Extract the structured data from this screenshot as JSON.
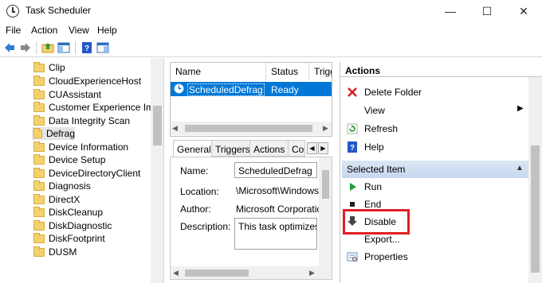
{
  "window": {
    "title": "Task Scheduler",
    "minimize": "—",
    "maximize": "☐",
    "close": "✕"
  },
  "menu": [
    "File",
    "Action",
    "View",
    "Help"
  ],
  "tree": {
    "items": [
      "Clip",
      "CloudExperienceHost",
      "CUAssistant",
      "Customer Experience Impr",
      "Data Integrity Scan",
      "Defrag",
      "Device Information",
      "Device Setup",
      "DeviceDirectoryClient",
      "Diagnosis",
      "DirectX",
      "DiskCleanup",
      "DiskDiagnostic",
      "DiskFootprint",
      "DUSM"
    ],
    "selected": "Defrag"
  },
  "task_list": {
    "columns": [
      "Name",
      "Status",
      "Trigg"
    ],
    "rows": [
      {
        "name": "ScheduledDefrag",
        "status": "Ready"
      }
    ]
  },
  "details": {
    "tabs": [
      "General",
      "Triggers",
      "Actions",
      "Co"
    ],
    "active_tab": "General",
    "name_label": "Name:",
    "name_value": "ScheduledDefrag",
    "location_label": "Location:",
    "location_value": "\\Microsoft\\Windows\\",
    "author_label": "Author:",
    "author_value": "Microsoft Corporation",
    "description_label": "Description:",
    "description_value": "This task optimizes lo"
  },
  "actions": {
    "header": "Actions",
    "folder_items": [
      "Delete Folder",
      "View",
      "Refresh",
      "Help"
    ],
    "selected_item_header": "Selected Item",
    "item_actions": [
      "Run",
      "End",
      "Disable",
      "Export...",
      "Properties"
    ]
  },
  "colors": {
    "selection": "#0078d7",
    "highlight_box": "#e11d24"
  }
}
